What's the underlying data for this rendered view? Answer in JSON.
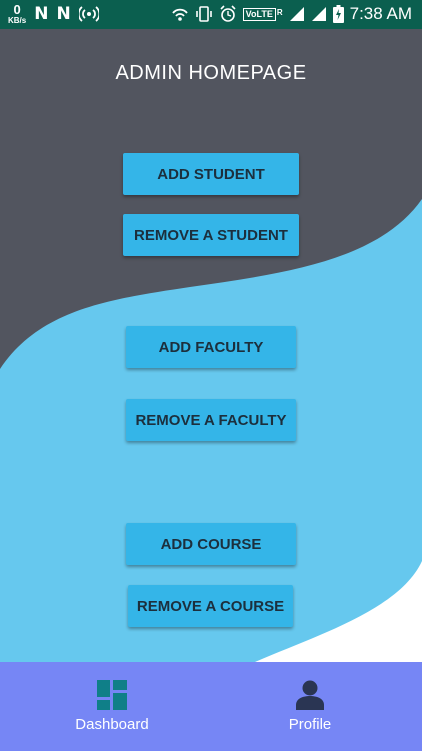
{
  "status_bar": {
    "speed_value": "0",
    "speed_unit": "KB/s",
    "n_icon_1": "N",
    "n_icon_2": "N",
    "volte": "VoLTE",
    "roaming": "R",
    "time": "7:38 AM"
  },
  "page": {
    "title": "ADMIN HOMEPAGE"
  },
  "buttons": {
    "add_student": "ADD STUDENT",
    "remove_student": "REMOVE A STUDENT",
    "add_faculty": "ADD FACULTY",
    "remove_faculty": "REMOVE A FACULTY",
    "add_course": "ADD COURSE",
    "remove_course": "REMOVE A COURSE"
  },
  "bottom_nav": {
    "dashboard": "Dashboard",
    "profile": "Profile"
  },
  "colors": {
    "status_bar": "#0b5f4f",
    "dark_background": "#52555f",
    "light_blue_background": "#66c8ee",
    "button": "#34b5e8",
    "button_text": "#1c2f3d",
    "bottom_nav": "#7686f5",
    "dashboard_icon": "#0f7f88",
    "profile_icon": "#2a3553"
  },
  "icons": {
    "dashboard": "dashboard-icon",
    "profile": "person-icon"
  }
}
